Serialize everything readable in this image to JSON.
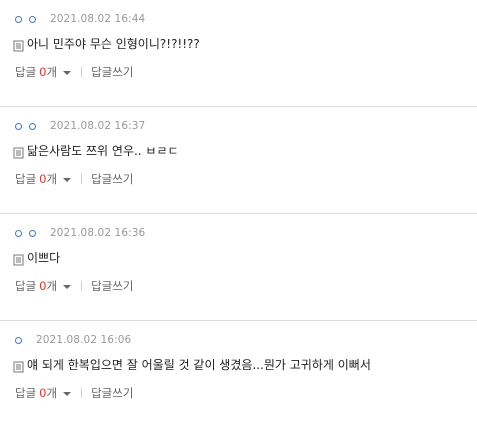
{
  "comments": [
    {
      "date": "2021.08.02 16:44",
      "text": "아니 민주야 무슨 인형이니?!?!!??",
      "reply_label": "답글",
      "reply_count": "0",
      "reply_unit": "개",
      "write_label": "답글쓰기"
    },
    {
      "date": "2021.08.02 16:37",
      "text": "닮은사람도 쯔위 연우.. ㅂㄹㄷ",
      "reply_label": "답글",
      "reply_count": "0",
      "reply_unit": "개",
      "write_label": "답글쓰기"
    },
    {
      "date": "2021.08.02 16:36",
      "text": "이쁘다",
      "reply_label": "답글",
      "reply_count": "0",
      "reply_unit": "개",
      "write_label": "답글쓰기"
    },
    {
      "date": "2021.08.02 16:06",
      "text": "얘 되게 한복입으면 잘 어울릴 것 같이 생겼음...뭔가 고귀하게 이뻐서",
      "reply_label": "답글",
      "reply_count": "0",
      "reply_unit": "개",
      "write_label": "답글쓰기"
    }
  ],
  "colors": {
    "accent_dot": "#3f7cc1",
    "reply_count": "#d63a2f",
    "divider": "#dcdcdc"
  }
}
